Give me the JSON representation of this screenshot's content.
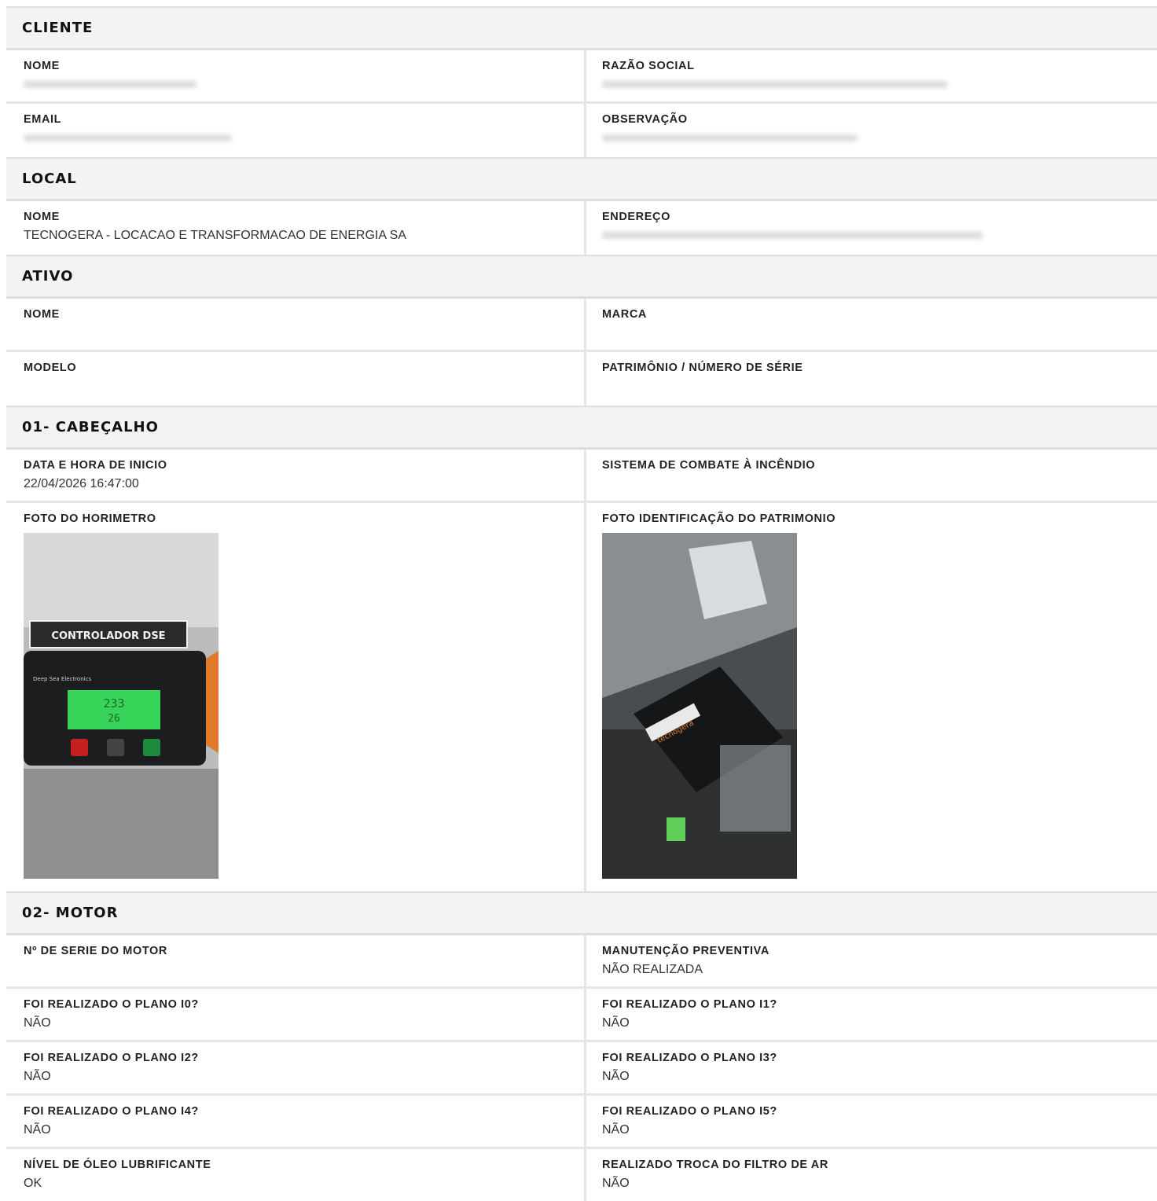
{
  "sections": {
    "cliente": {
      "title": "CLIENTE",
      "nome_label": "NOME",
      "razao_social_label": "RAZÃO SOCIAL",
      "email_label": "EMAIL",
      "observacao_label": "OBSERVAÇÃO"
    },
    "local": {
      "title": "LOCAL",
      "nome_label": "NOME",
      "nome_value": "TECNOGERA - LOCACAO E TRANSFORMACAO DE ENERGIA SA",
      "endereco_label": "ENDEREÇO"
    },
    "ativo": {
      "title": "ATIVO",
      "nome_label": "NOME",
      "marca_label": "MARCA",
      "modelo_label": "MODELO",
      "patrimonio_label": "PATRIMÔNIO / NÚMERO DE SÉRIE"
    },
    "cabecalho": {
      "title": "01- CABEÇALHO",
      "data_label": "DATA E HORA DE INICIO",
      "data_value": "22/04/2026 16:47:00",
      "sistema_label": "SISTEMA DE COMBATE À INCÊNDIO",
      "foto_horimetro_label": "FOTO DO HORIMETRO",
      "foto_patrimonio_label": "FOTO IDENTIFICAÇÃO DO PATRIMONIO",
      "photo1": {
        "sign": "CONTROLADOR DSE",
        "brand": "Deep Sea Electronics",
        "display_line1": "233",
        "display_line2": "26"
      },
      "photo2": {
        "brand": "tecnogera"
      }
    },
    "motor": {
      "title": "02- MOTOR",
      "serie_label": "Nº DE SERIE DO MOTOR",
      "manutencao_label": "MANUTENÇÃO PREVENTIVA",
      "manutencao_value": "NÃO REALIZADA",
      "i0_label": "FOI REALIZADO O PLANO I0?",
      "i0_value": "NÃO",
      "i1_label": "FOI REALIZADO O PLANO I1?",
      "i1_value": "NÃO",
      "i2_label": "FOI REALIZADO O PLANO I2?",
      "i2_value": "NÃO",
      "i3_label": "FOI REALIZADO O PLANO I3?",
      "i3_value": "NÃO",
      "i4_label": "FOI REALIZADO O PLANO I4?",
      "i4_value": "NÃO",
      "i5_label": "FOI REALIZADO O PLANO I5?",
      "i5_value": "NÃO",
      "oleo_label": "NÍVEL DE ÓLEO LUBRIFICANTE",
      "oleo_value": "OK",
      "filtro_label": "REALIZADO TROCA DO FILTRO DE AR",
      "filtro_value": "NÃO"
    }
  }
}
